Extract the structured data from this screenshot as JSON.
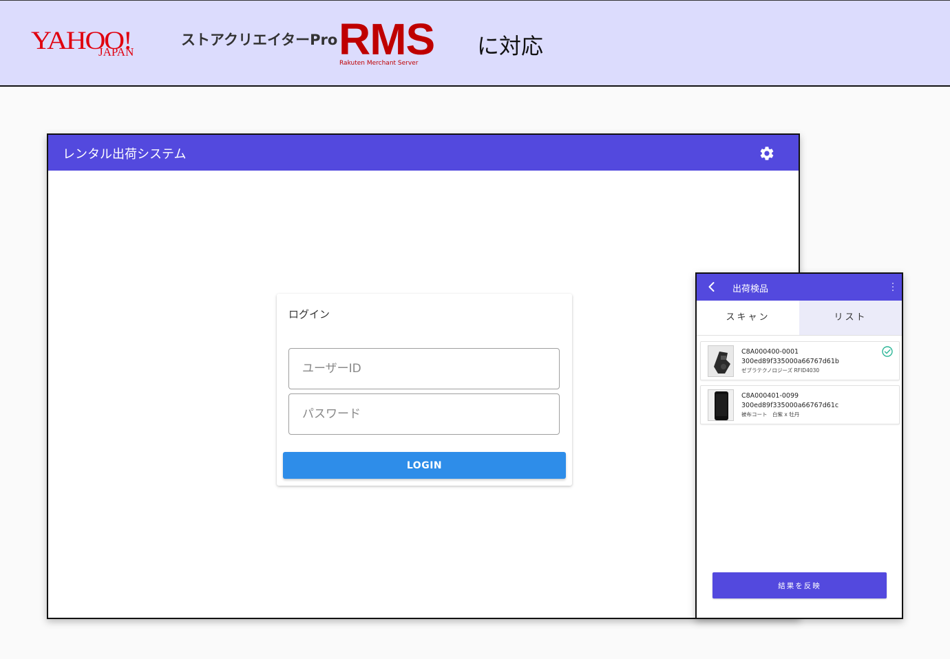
{
  "banner": {
    "yahoo_logo_text": "YAHOO!",
    "yahoo_logo_sub": "JAPAN",
    "store_creator": "ストアクリエイターPro",
    "rms_logo_text": "RMS",
    "rms_logo_sub": "Rakuten Merchant Server",
    "compat_text": "に対応"
  },
  "desktop": {
    "app_title": "レンタル出荷システム",
    "settings_icon": "gear-icon",
    "login": {
      "title": "ログイン",
      "user_placeholder": "ユーザーID",
      "password_placeholder": "パスワード",
      "button_label": "LOGIN"
    }
  },
  "phone": {
    "back_icon": "chevron-left-icon",
    "title": "出荷検品",
    "more_icon": "more-vert-icon",
    "tabs": [
      {
        "label": "スキャン",
        "active": true
      },
      {
        "label": "リスト",
        "active": false
      }
    ],
    "items": [
      {
        "code": "C8A000400-0001",
        "tag": "300ed89f335000a66767d61b",
        "name": "ゼブラテクノロジーズ RFID4030",
        "checked": true,
        "thumb": "scanner-image"
      },
      {
        "code": "C8A000401-0099",
        "tag": "300ed89f335000a66767d61c",
        "name": "被布コート　白紫 x 牡丹",
        "checked": false,
        "thumb": "phone-image"
      }
    ],
    "apply_button": "結果を反映"
  },
  "colors": {
    "primary": "#5349de",
    "login_button": "#2e8de9",
    "banner_bg": "#dcdcfd",
    "yahoo_red": "#e0010f",
    "rms_red": "#bf0000",
    "check_green": "#2bb596"
  }
}
